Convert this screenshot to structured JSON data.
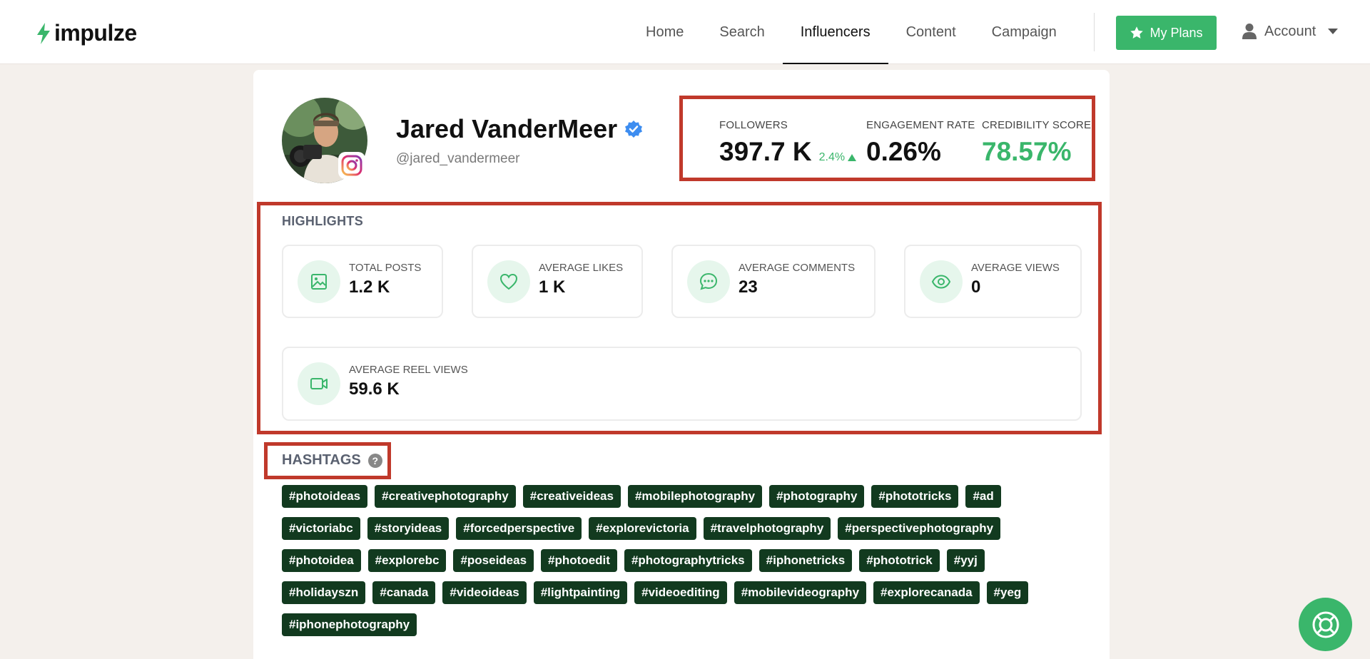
{
  "brand": {
    "name": "impulze",
    "accent": "#3ab66b"
  },
  "nav": {
    "items": [
      {
        "label": "Home"
      },
      {
        "label": "Search"
      },
      {
        "label": "Influencers",
        "active": true
      },
      {
        "label": "Content"
      },
      {
        "label": "Campaign"
      }
    ],
    "plans_label": "My Plans",
    "account_label": "Account"
  },
  "profile": {
    "name": "Jared VanderMeer",
    "handle": "@jared_vandermeer",
    "platform": "instagram-icon",
    "verified": true
  },
  "stats": {
    "followers": {
      "label": "FOLLOWERS",
      "value": "397.7 K",
      "growth": "2.4%"
    },
    "engagement": {
      "label": "ENGAGEMENT RATE",
      "value": "0.26%"
    },
    "credibility": {
      "label": "CREDIBILITY SCORE",
      "value": "78.57%",
      "color": "#3ab66b"
    }
  },
  "highlights": {
    "title": "HIGHLIGHTS",
    "items": [
      {
        "label": "TOTAL POSTS",
        "value": "1.2 K",
        "icon": "image-icon"
      },
      {
        "label": "AVERAGE LIKES",
        "value": "1 K",
        "icon": "heart-icon"
      },
      {
        "label": "AVERAGE COMMENTS",
        "value": "23",
        "icon": "comment-icon"
      },
      {
        "label": "AVERAGE VIEWS",
        "value": "0",
        "icon": "eye-icon"
      },
      {
        "label": "AVERAGE REEL VIEWS",
        "value": "59.6 K",
        "icon": "video-icon"
      }
    ]
  },
  "hashtags": {
    "title": "HASHTAGS",
    "tags": [
      "#photoideas",
      "#creativephotography",
      "#creativeideas",
      "#mobilephotography",
      "#photography",
      "#phototricks",
      "#ad",
      "#victoriabc",
      "#storyideas",
      "#forcedperspective",
      "#explorevictoria",
      "#travelphotography",
      "#perspectivephotography",
      "#photoidea",
      "#explorebc",
      "#poseideas",
      "#photoedit",
      "#photographytricks",
      "#iphonetricks",
      "#phototrick",
      "#yyj",
      "#holidayszn",
      "#canada",
      "#videoideas",
      "#lightpainting",
      "#videoediting",
      "#mobilevideography",
      "#explorecanada",
      "#yeg",
      "#iphonephotography"
    ]
  }
}
